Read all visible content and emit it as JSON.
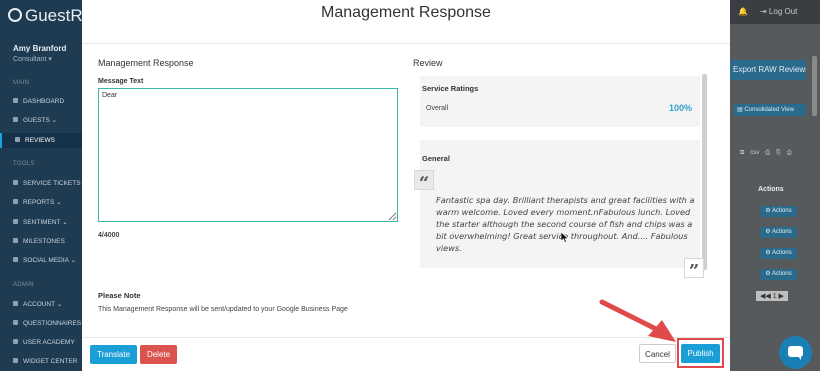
{
  "app": {
    "logo": "GuestR"
  },
  "user": {
    "name": "Amy Branford",
    "role": "Consultant ▾"
  },
  "sidebar": {
    "sections": [
      {
        "label": "MAIN"
      },
      {
        "label": "TOOLS"
      },
      {
        "label": "ADMIN"
      }
    ],
    "items": [
      {
        "label": "DASHBOARD"
      },
      {
        "label": "GUESTS ⌄"
      },
      {
        "label": "REVIEWS"
      },
      {
        "label": "SERVICE TICKETS"
      },
      {
        "label": "REPORTS ⌄"
      },
      {
        "label": "SENTIMENT ⌄"
      },
      {
        "label": "MILESTONES"
      },
      {
        "label": "SOCIAL MEDIA ⌄"
      },
      {
        "label": "ACCOUNT ⌄"
      },
      {
        "label": "QUESTIONNAIRES"
      },
      {
        "label": "USER ACADEMY"
      },
      {
        "label": "WIDGET CENTER"
      }
    ]
  },
  "topbar": {
    "logout": "⇥ Log Out",
    "bell": "🔔"
  },
  "background": {
    "export_button": "Export RAW Reviews",
    "consolidated_button": "▤ Consolidated View",
    "tools": [
      "⧉",
      "csv",
      "⎙",
      "⎘",
      "⎙"
    ],
    "actions_header": "Actions",
    "action_button": "⚙ Actions",
    "pager": "◀◀ 1 ▶"
  },
  "modal": {
    "title": "Management Response",
    "left_heading": "Management Response",
    "message_label": "Message Text",
    "message_value": "Dear",
    "char_count": "4/4000",
    "review_heading": "Review",
    "ratings_title": "Service Ratings",
    "rating_label": "Overall",
    "rating_value": "100%",
    "general_title": "General",
    "review_text": "Fantastic spa day. Brilliant therapists and great facilities with a warm welcome. Loved every moment.nFabulous lunch. Loved the starter although the second course of fish and chips was a bit overwhelming! Great service throughout. And.... Fabulous views.",
    "note_title": "Please Note",
    "note_text": "This Management Response will be sent/updated to your Google Business Page",
    "buttons": {
      "translate": "Translate",
      "delete": "Delete",
      "cancel": "Cancel",
      "publish": "Publish"
    }
  },
  "colors": {
    "primary": "#1a9ed6",
    "danger": "#d9534f",
    "highlight": "#e04a4a",
    "rating": "#2ea0c8",
    "sidebar": "#1e3b52"
  }
}
